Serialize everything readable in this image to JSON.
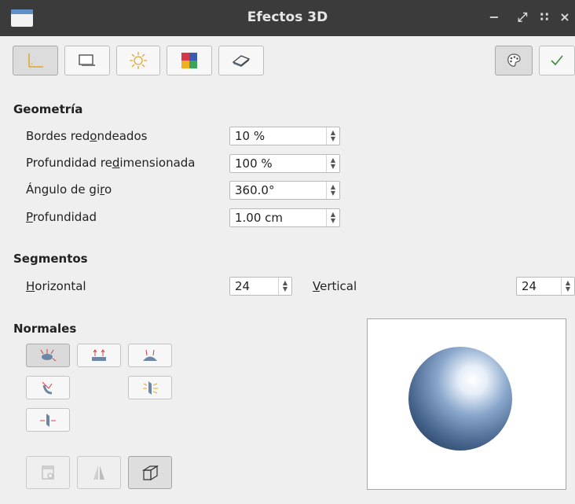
{
  "window": {
    "title": "Efectos 3D",
    "controls": {
      "minimize": "−",
      "restore": "⤢",
      "pin": "∷",
      "close": "×"
    }
  },
  "toolbar": {
    "tabs": [
      {
        "name": "geometry-tab",
        "icon": "axis-icon",
        "active": true
      },
      {
        "name": "shading-tab",
        "icon": "monitor-icon",
        "active": false
      },
      {
        "name": "illumination-tab",
        "icon": "sun-icon",
        "active": false
      },
      {
        "name": "textures-tab",
        "icon": "color-squares-icon",
        "active": false
      },
      {
        "name": "material-tab",
        "icon": "eraser-icon",
        "active": false
      }
    ],
    "right_buttons": [
      {
        "name": "palette-button",
        "icon": "palette-icon"
      },
      {
        "name": "apply-button",
        "icon": "checkmark-icon"
      }
    ]
  },
  "geometria": {
    "title": "Geometría",
    "fields": [
      {
        "label_pre": "Bordes red",
        "label_u": "o",
        "label_post": "ndeados",
        "value": "10 %"
      },
      {
        "label_pre": "Profundidad re",
        "label_u": "d",
        "label_post": "imensionada",
        "value": "100 %"
      },
      {
        "label_pre": "Ángulo de gi",
        "label_u": "r",
        "label_post": "o",
        "value": "360.0°"
      },
      {
        "label_pre": "",
        "label_u": "P",
        "label_post": "rofundidad",
        "value": "1.00 cm"
      }
    ]
  },
  "segmentos": {
    "title": "Segmentos",
    "horizontal_label_u": "H",
    "horizontal_label_post": "orizontal",
    "horizontal_value": "24",
    "vertical_label_u": "V",
    "vertical_label_post": "ertical",
    "vertical_value": "24"
  },
  "normales": {
    "title": "Normales",
    "buttons": [
      {
        "name": "object-specific-normals-icon",
        "active": true
      },
      {
        "name": "flat-normals-icon",
        "active": false
      },
      {
        "name": "spherical-normals-icon",
        "active": false
      },
      {
        "name": "invert-normals-icon",
        "active": false
      },
      {
        "name": "two-sided-lighting-icon",
        "active": false
      },
      {
        "name": "double-sided-icon",
        "active": false
      }
    ]
  },
  "bottom_buttons": [
    {
      "name": "convert-to-3d-icon",
      "active": false,
      "enabled": false
    },
    {
      "name": "convert-to-lathe-icon",
      "active": false,
      "enabled": false
    },
    {
      "name": "perspective-icon",
      "active": true,
      "enabled": true
    }
  ],
  "colors": {
    "titlebar": "#3b3b3b",
    "sphere_highlight": "#ffffff",
    "sphere_mid": "#8aa8cc",
    "sphere_shadow": "#2e4a6e",
    "checkmark": "#3c8c3c"
  }
}
